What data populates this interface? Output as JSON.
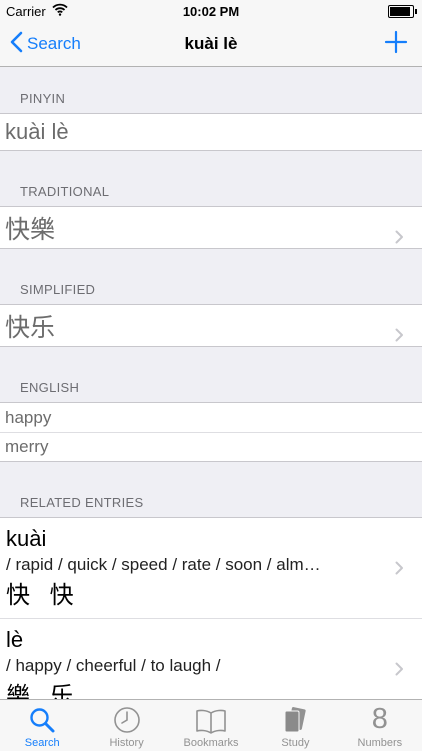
{
  "status_bar": {
    "carrier": "Carrier",
    "time": "10:02 PM",
    "battery_level": 1.0
  },
  "nav": {
    "back_label": "Search",
    "title": "kuài lè",
    "add_icon": "plus-icon"
  },
  "sections": {
    "pinyin": {
      "header": "PINYIN",
      "value": "kuài lè"
    },
    "traditional": {
      "header": "TRADITIONAL",
      "value": "快樂"
    },
    "simplified": {
      "header": "SIMPLIFIED",
      "value": "快乐"
    },
    "english": {
      "header": "ENGLISH",
      "items": [
        "happy",
        "merry"
      ]
    },
    "related": {
      "header": "RELATED ENTRIES",
      "entries": [
        {
          "pinyin": "kuài",
          "definition": "/ rapid / quick / speed / rate / soon / alm…",
          "hanzi": "快 快"
        },
        {
          "pinyin": "lè",
          "definition": "/ happy / cheerful / to laugh /",
          "hanzi": "樂 乐"
        }
      ]
    }
  },
  "tab_bar": {
    "tabs": [
      {
        "label": "Search",
        "icon": "search-icon",
        "active": true
      },
      {
        "label": "History",
        "icon": "clock-icon",
        "active": false
      },
      {
        "label": "Bookmarks",
        "icon": "book-icon",
        "active": false
      },
      {
        "label": "Study",
        "icon": "cards-icon",
        "active": false
      },
      {
        "label": "Numbers",
        "icon": "number-8-icon",
        "glyph": "8",
        "active": false
      }
    ]
  },
  "colors": {
    "accent": "#157efb",
    "inactive": "#929292"
  }
}
